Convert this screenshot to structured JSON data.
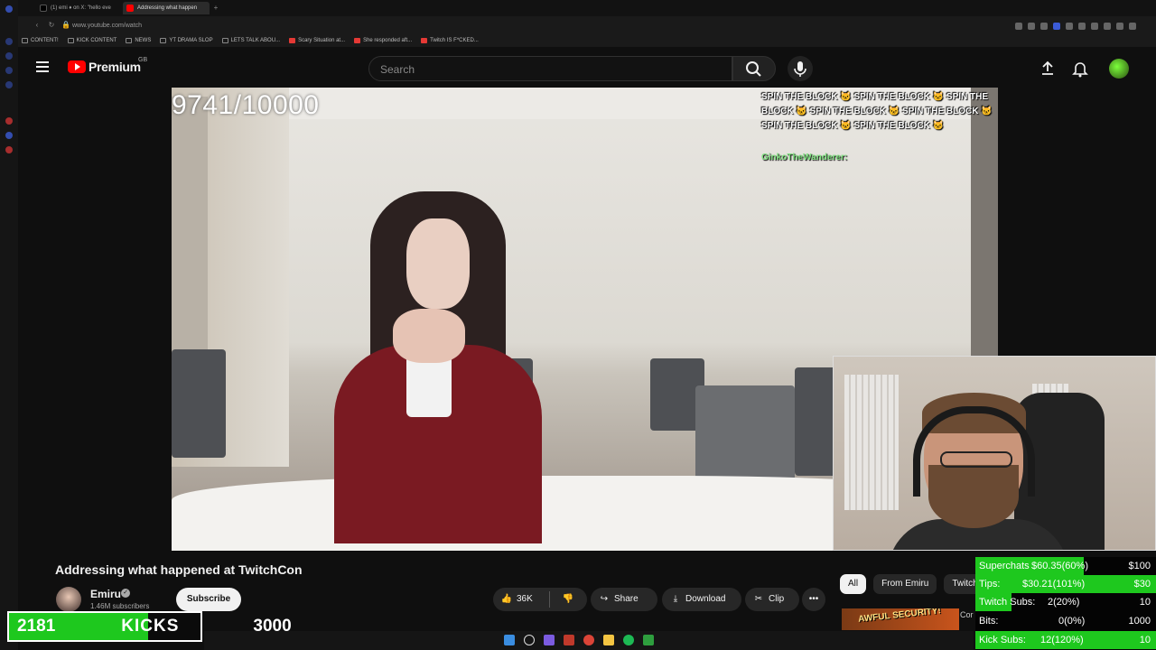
{
  "browser": {
    "tabs": [
      {
        "label": "(1) emi ♦ on X: \"hello eve",
        "active": false
      },
      {
        "label": "Addressing what happen",
        "active": true
      }
    ],
    "url": "www.youtube.com/watch",
    "bookmarks": [
      "CONTENT!",
      "KICK CONTENT",
      "NEWS",
      "YT DRAMA SLOP",
      "LETS TALK ABOU...",
      "Scary Situation at...",
      "She responded aft...",
      "Twitch IS F*CKED..."
    ]
  },
  "header": {
    "logo_label": "Premium",
    "region": "GB",
    "search_placeholder": "Search"
  },
  "video": {
    "counter_overlay": "9741/10000",
    "chat_overlay_text": "SPIN THE BLOCK 🐱 SPIN THE BLOCK 🐱 SPIN THE BLOCK 🐱 SPIN THE BLOCK 🐱 SPIN THE BLOCK 🐱 SPIN THE BLOCK 🐱 SPIN THE BLOCK 🐱",
    "chat_overlay_user": "GinkoTheWanderer:",
    "title": "Addressing what happened at TwitchCon"
  },
  "channel": {
    "name": "Emiru",
    "subscribers": "1.46M subscribers",
    "subscribe_label": "Subscribe"
  },
  "actions": {
    "likes": "36K",
    "share": "Share",
    "download": "Download",
    "clip": "Clip",
    "more": "•••"
  },
  "chips": [
    "All",
    "From Emiru",
    "Twitch"
  ],
  "next_video": {
    "thumb_text": "AWFUL SECURITY!",
    "title": "Cor"
  },
  "kicks_overlay": {
    "count": "2181",
    "label": "KICKS",
    "goal": "3000",
    "progress": 0.727
  },
  "goals_overlay": [
    {
      "label": "Superchats",
      "value": "$60.35(60%)",
      "target": "$100",
      "progress": 0.6
    },
    {
      "label": "Tips:",
      "value": "$30.21(101%)",
      "target": "$30",
      "progress": 1.0
    },
    {
      "label": "Twitch Subs:",
      "value": "2(20%)",
      "target": "10",
      "progress": 0.2
    },
    {
      "label": "Bits:",
      "value": "0(0%)",
      "target": "1000",
      "progress": 0.0
    },
    {
      "label": "Kick Subs:",
      "value": "12(120%)",
      "target": "10",
      "progress": 1.0
    }
  ],
  "colors": {
    "yt_red": "#ff0000",
    "goal_green": "#1ec81e",
    "background": "#0f0f0f"
  }
}
